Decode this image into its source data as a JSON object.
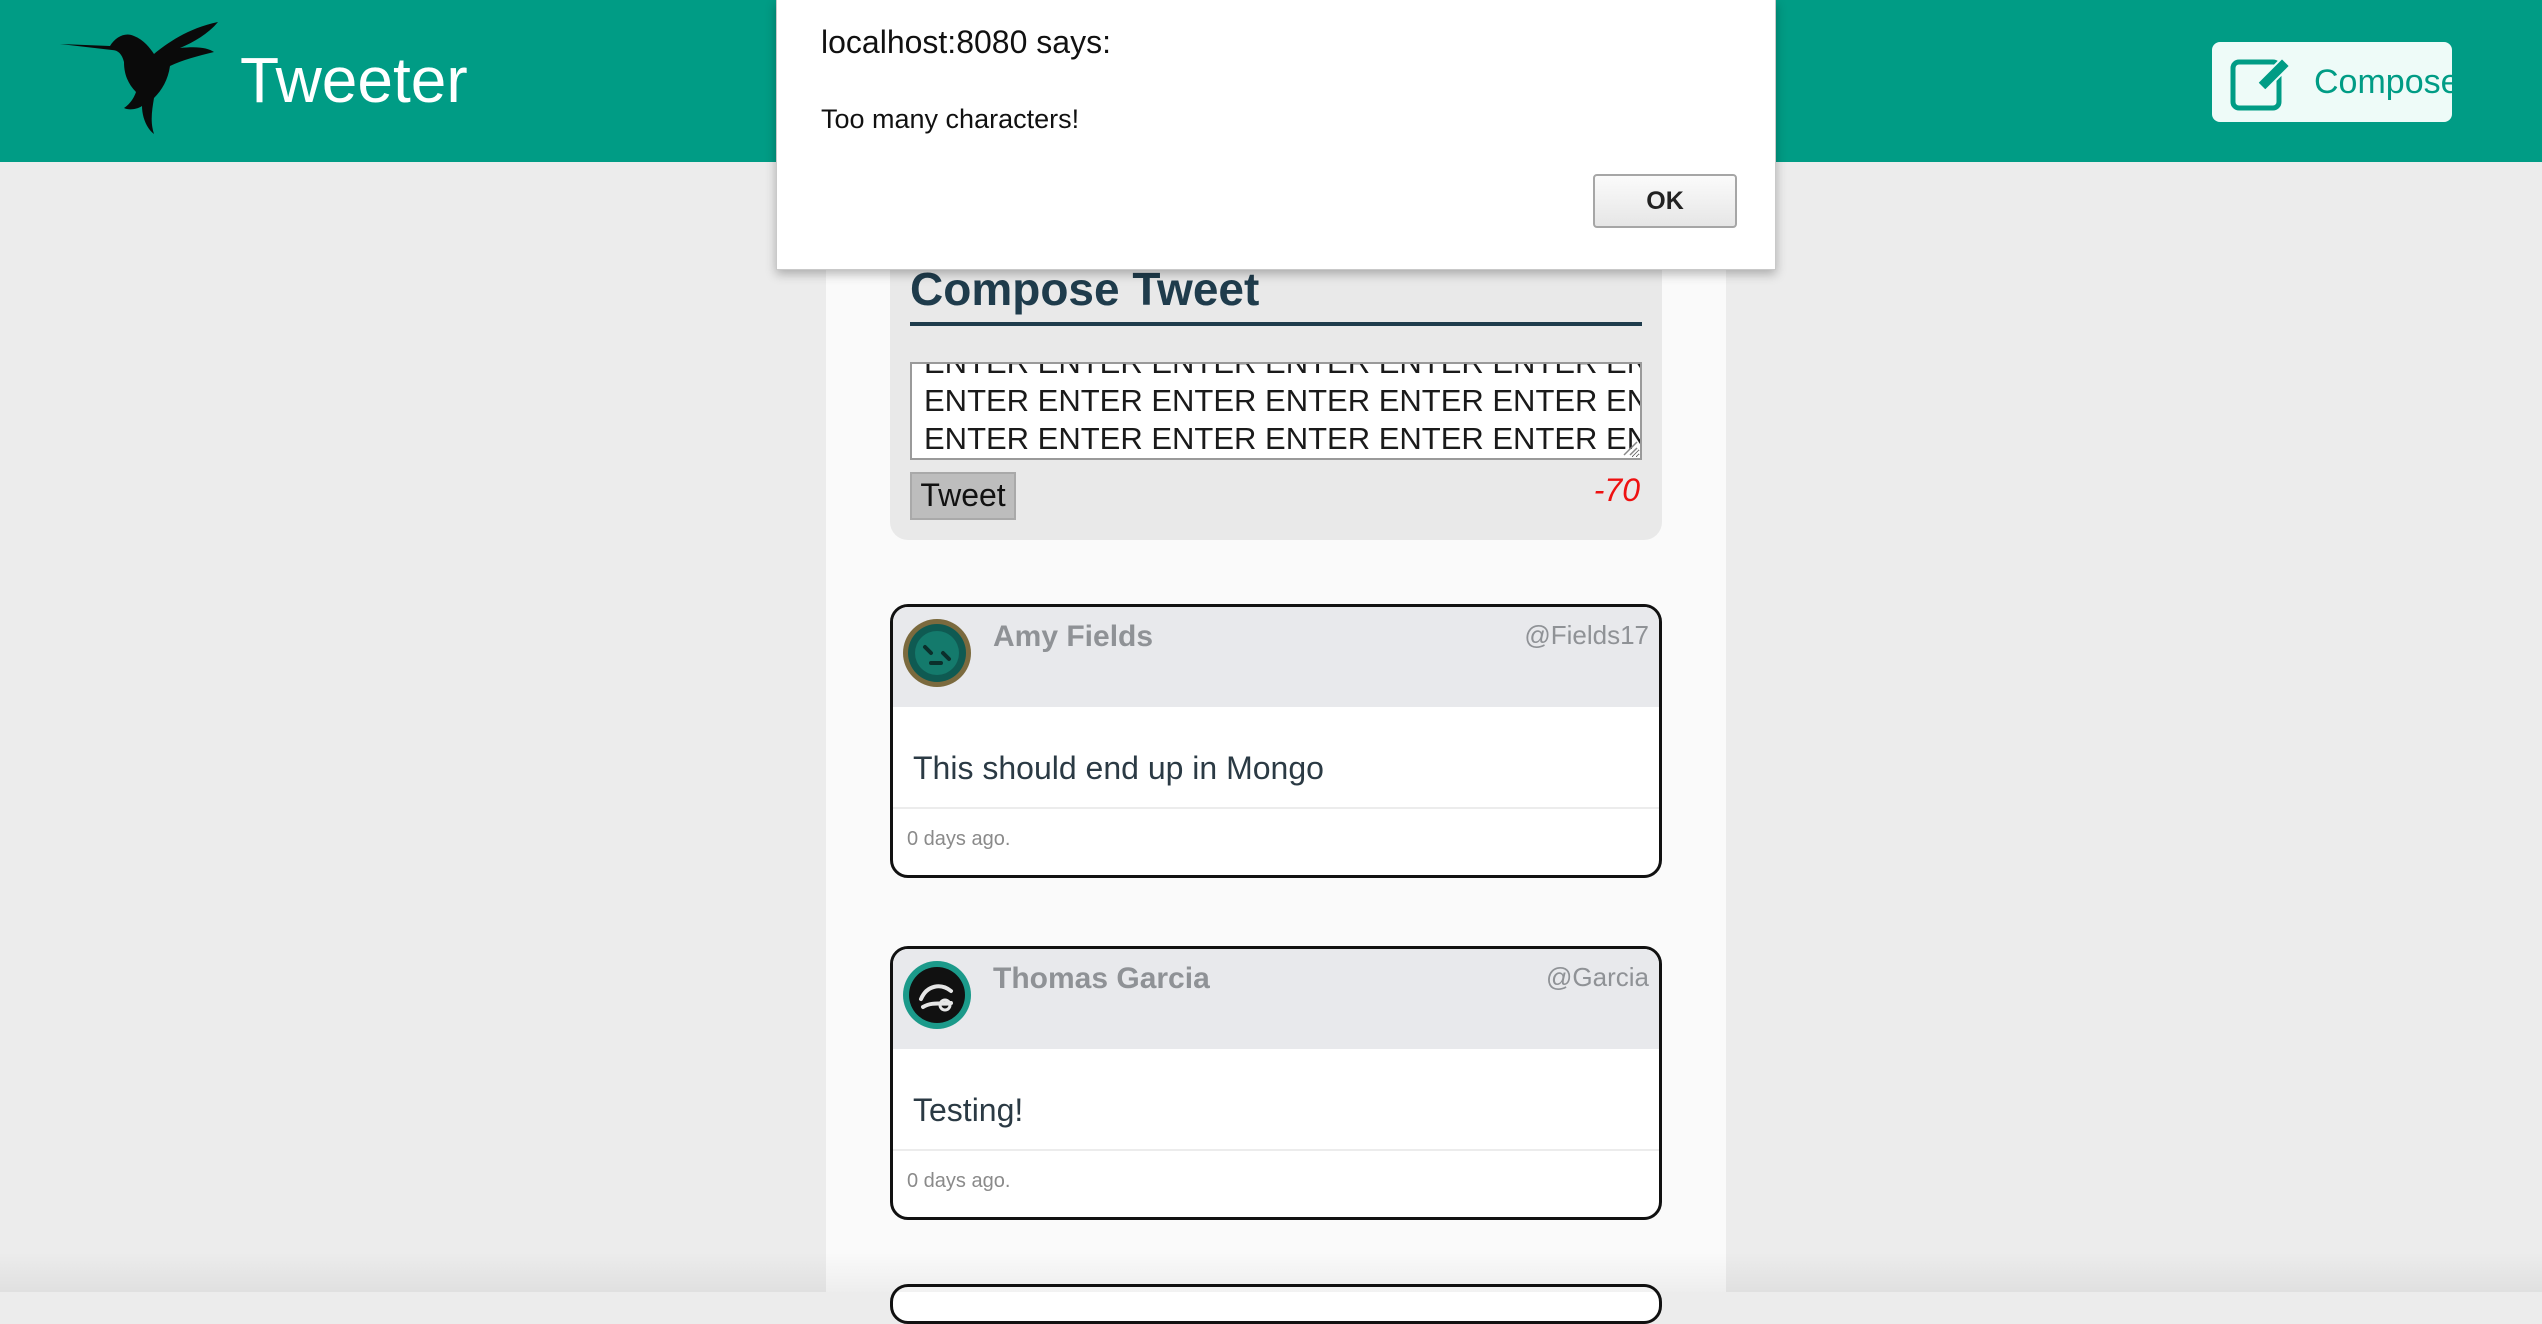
{
  "header": {
    "brand": "Tweeter",
    "compose_label": "Compose",
    "logo_icon": "hummingbird-icon",
    "compose_icon": "edit-icon"
  },
  "compose": {
    "title": "Compose Tweet",
    "textarea_lines": [
      "ENTER ENTER ENTER ENTER ENTER ENTER ENTER",
      "ENTER ENTER ENTER ENTER ENTER ENTER ENTER",
      "ENTER ENTER ENTER ENTER ENTER ENTER ENTER"
    ],
    "tweet_button": "Tweet",
    "counter": "-70"
  },
  "tweets": [
    {
      "name": "Amy Fields",
      "handle": "@Fields17",
      "text": "This should end up in Mongo",
      "time": "0 days ago."
    },
    {
      "name": "Thomas Garcia",
      "handle": "@Garcia",
      "text": "Testing!",
      "time": "0 days ago."
    }
  ],
  "dialog": {
    "title": "localhost:8080 says:",
    "message": "Too many characters!",
    "ok_label": "OK"
  },
  "colors": {
    "brand_teal": "#009c85",
    "counter_red": "#e11111",
    "title_navy": "#1f3c4c"
  }
}
